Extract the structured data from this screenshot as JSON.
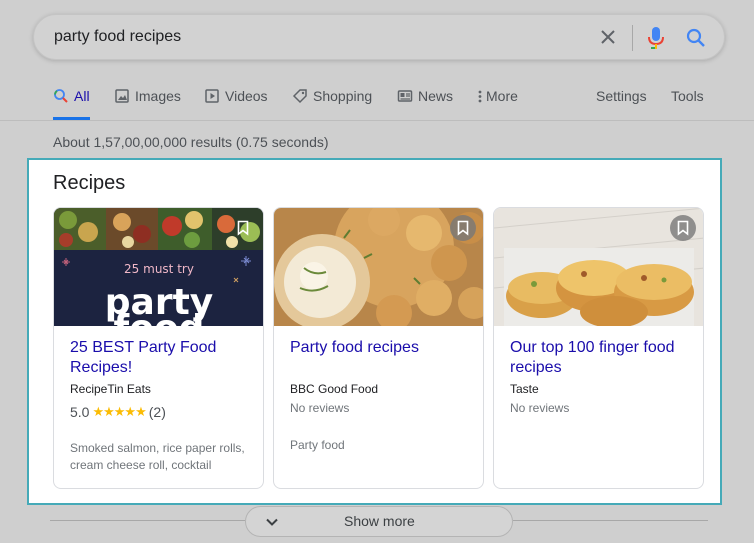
{
  "search": {
    "query": "party food recipes"
  },
  "tabs": [
    {
      "label": "All",
      "icon": "search-icon",
      "active": true
    },
    {
      "label": "Images",
      "icon": "image-icon"
    },
    {
      "label": "Videos",
      "icon": "video-icon"
    },
    {
      "label": "Shopping",
      "icon": "tag-icon"
    },
    {
      "label": "News",
      "icon": "news-icon"
    },
    {
      "label": "More",
      "icon": "more-vert-icon"
    },
    {
      "label": "Settings"
    },
    {
      "label": "Tools"
    }
  ],
  "result_stats": "About 1,57,00,00,000 results (0.75 seconds)",
  "recipes": {
    "title": "Recipes",
    "cards": [
      {
        "title": "25 BEST Party Food Recipes!",
        "source": "RecipeTin Eats",
        "rating": "5.0",
        "stars": "★★★★★",
        "review_count": "(2)",
        "description": "Smoked salmon, rice paper rolls, cream cheese roll, cocktail",
        "image_text_small": "25 must try",
        "image_text_big": "party",
        "image_text_cut": "food"
      },
      {
        "title": "Party food recipes",
        "source": "BBC Good Food",
        "reviews": "No reviews",
        "description": "Party food"
      },
      {
        "title": "Our top 100 finger food recipes",
        "source": "Taste",
        "reviews": "No reviews"
      }
    ]
  },
  "show_more": {
    "label": "Show more"
  },
  "colors": {
    "link": "#1a0dab",
    "accent": "#1a73e8",
    "panel_border": "#45aab8",
    "star": "#fbbc04"
  }
}
